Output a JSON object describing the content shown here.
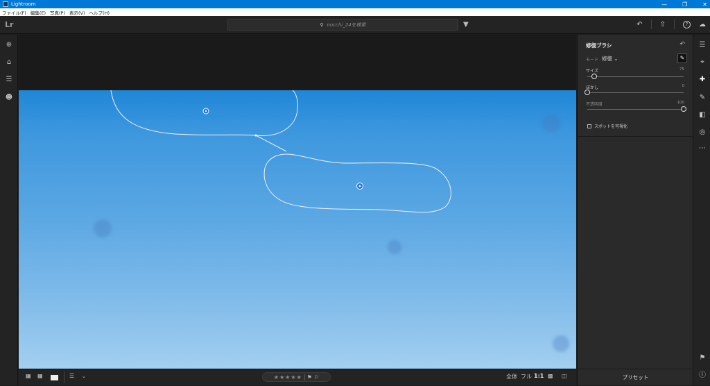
{
  "window": {
    "title": "Lightroom"
  },
  "menu": [
    "ファイル(F)",
    "編集(E)",
    "写真(P)",
    "表示(V)",
    "ヘルプ(H)"
  ],
  "topbar": {
    "logo": "Lr",
    "search_placeholder": "nocchi_24を検索"
  },
  "panel": {
    "title": "修復ブラシ",
    "mode_label": "モード",
    "mode_value": "修復",
    "sliders": [
      {
        "label": "サイズ",
        "value": "75",
        "fraction": 0.07
      },
      {
        "label": "ぼかし",
        "value": "0",
        "fraction": 0.0
      },
      {
        "label": "不透明度",
        "value": "100",
        "fraction": 1.0
      }
    ],
    "checkbox_label": "スポットを可視化",
    "checkbox_checked": false,
    "presets_label": "プリセット"
  },
  "bottombar": {
    "fit_label": "全体",
    "fill_label": "フル",
    "ratio_label": "1:1",
    "stars": "★★★★★"
  },
  "colors": {
    "accent": "#0078d7",
    "selection_pin": "#1a73e8"
  },
  "icons": {
    "left": [
      "add-photos-icon",
      "home-icon",
      "library-icon",
      "people-icon"
    ],
    "right": [
      "edit-sliders-icon",
      "crop-icon",
      "healing-brush-icon",
      "brush-icon",
      "gradient-icon",
      "radial-icon",
      "more-icon",
      "tag-icon",
      "info-icon"
    ]
  }
}
